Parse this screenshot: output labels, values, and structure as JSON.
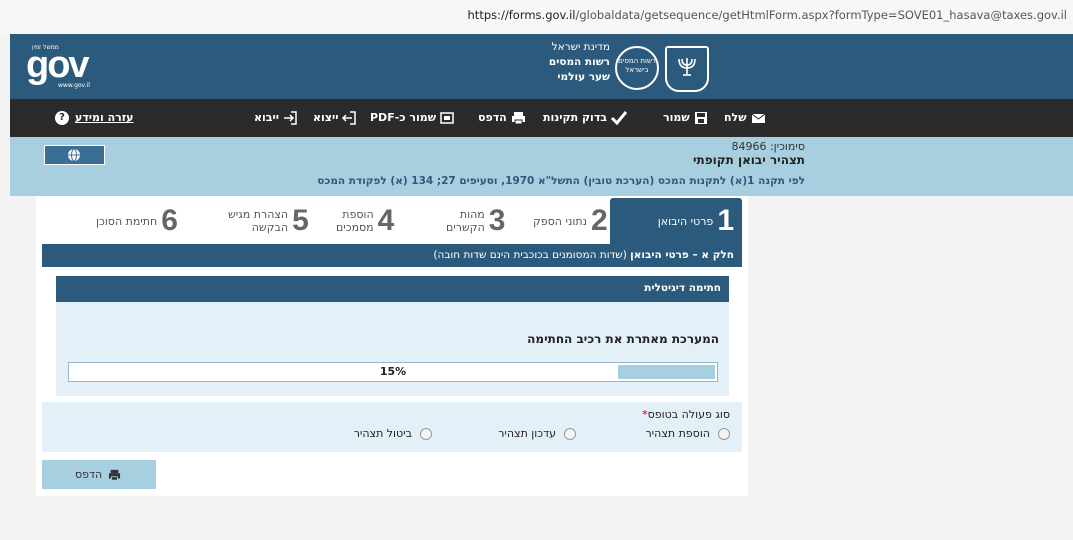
{
  "browser": {
    "url_host": "https://forms.gov.il",
    "url_path": "/globaldata/getsequence/getHtmlForm.aspx?formType=SOVE01_hasava@taxes.gov.il"
  },
  "header": {
    "gov_logo": "gov",
    "gov_logo_small": "ממשל זמין",
    "gov_logo_www": "www.gov.il",
    "line1": "מדינת ישראל",
    "line2": "רשות המסים",
    "line3": "שער עולמי",
    "circle_text": "רשות המסים בישראל"
  },
  "toolbar": {
    "send": "שלח",
    "save": "שמור",
    "check": "בדוק תקינות",
    "print": "הדפס",
    "save_pdf": "שמור כ-PDF",
    "export": "ייצוא",
    "import": "ייבוא",
    "help": "עזרה ומידע",
    "help_q": "?"
  },
  "info": {
    "sim": "סימוכין: 84966",
    "title": "תצהיר יבואן תקופתי",
    "law": "לפי תקנה 1(א) לתקנות המכס (הערכת טובין) התשל\"א 1970, וסעיפים 27; 134 (א) לפקודת המכס"
  },
  "steps": [
    {
      "num": "1",
      "label": "פרטי היבואן",
      "active": true
    },
    {
      "num": "2",
      "label": "נתוני הספק"
    },
    {
      "num": "3",
      "label": "מהות\nהקשרים"
    },
    {
      "num": "4",
      "label": "הוספת\nמסמכים"
    },
    {
      "num": "5",
      "label": "הצהרת מגיש\nהבקשה"
    },
    {
      "num": "6",
      "label": "חתימת הסוכן"
    }
  ],
  "part_a": {
    "title": "חלק א – פרטי היבואן",
    "note": "(שדות המסומנים בכוכבית הינם שדות חובה)"
  },
  "signature": {
    "header": "חתימה דיגיטלית",
    "message": "המערכת מאתרת את רכיב החתימה",
    "progress_text": "15%",
    "progress": 0.15
  },
  "action": {
    "star": "*",
    "label": "סוג פעולה בטופס",
    "options": [
      "הוספת תצהיר",
      "עדכון תצהיר",
      "ביטול תצהיר"
    ]
  },
  "print_button": "הדפס",
  "colors": {
    "brand": "#2c5a7d",
    "light": "#a8cfe0",
    "toolbar": "#2b2b2b"
  }
}
